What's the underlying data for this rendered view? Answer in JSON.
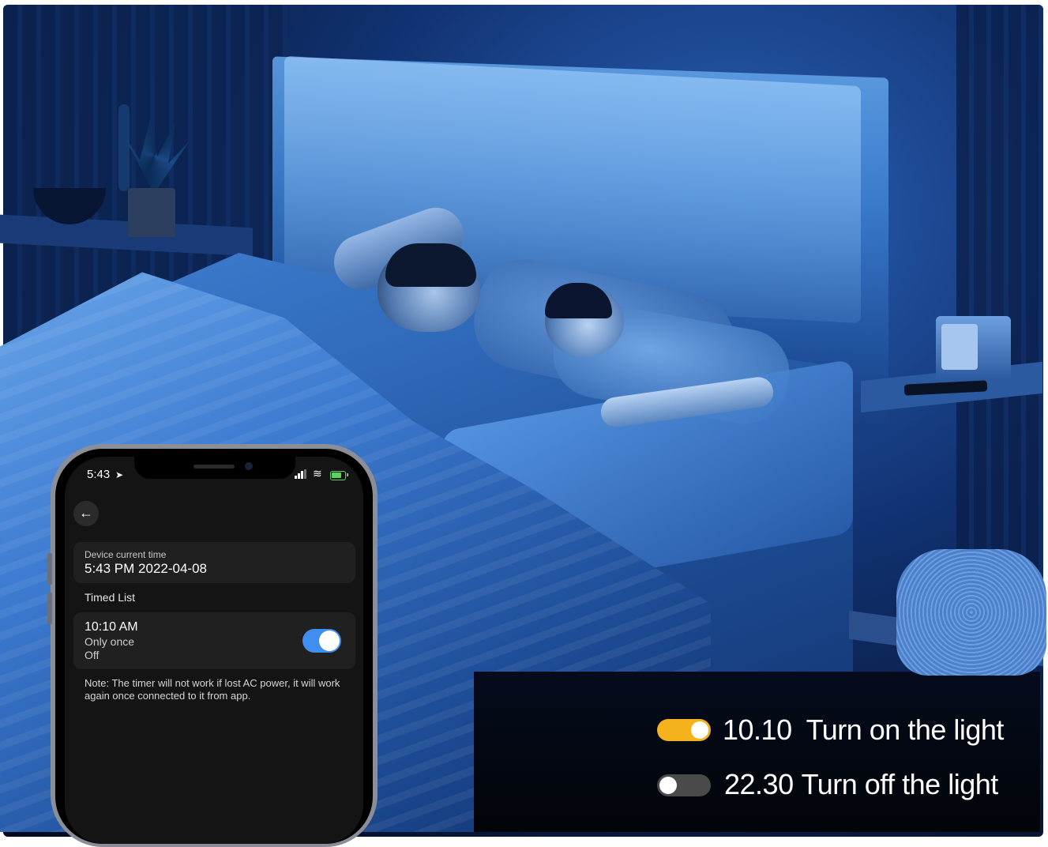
{
  "phone": {
    "status_time": "5:43",
    "device_time_label": "Device current time",
    "device_time_value": "5:43 PM 2022-04-08",
    "timed_list_label": "Timed List",
    "timer": {
      "time": "10:10 AM",
      "repeat": "Only once",
      "action": "Off",
      "enabled": true
    },
    "note": "Note: The timer will not work if lost AC power, it will work again once connected to it from app."
  },
  "legend": [
    {
      "time": "10.10",
      "text": "Turn on the light",
      "state": "on",
      "color": "#f6b21c"
    },
    {
      "time": "22.30",
      "text": "Turn off the light",
      "state": "off",
      "color": "#4a4a4a"
    }
  ]
}
